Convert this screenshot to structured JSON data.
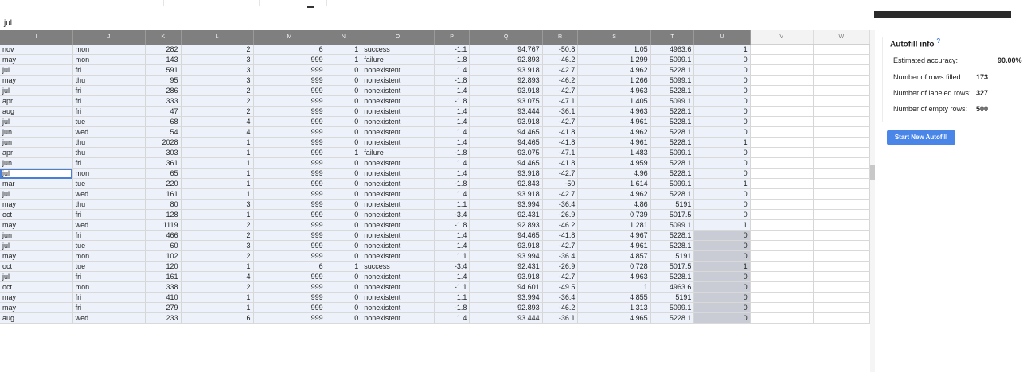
{
  "formula_bar": {
    "value": "jul"
  },
  "columns": [
    "I",
    "J",
    "K",
    "L",
    "M",
    "N",
    "O",
    "P",
    "Q",
    "R",
    "S",
    "T",
    "U",
    "V",
    "W"
  ],
  "rows": [
    [
      "nov",
      "mon",
      "282",
      "2",
      "6",
      "1",
      "success",
      "-1.1",
      "94.767",
      "-50.8",
      "1.05",
      "4963.6",
      "1"
    ],
    [
      "may",
      "mon",
      "143",
      "3",
      "999",
      "1",
      "failure",
      "-1.8",
      "92.893",
      "-46.2",
      "1.299",
      "5099.1",
      "0"
    ],
    [
      "jul",
      "fri",
      "591",
      "3",
      "999",
      "0",
      "nonexistent",
      "1.4",
      "93.918",
      "-42.7",
      "4.962",
      "5228.1",
      "0"
    ],
    [
      "may",
      "thu",
      "95",
      "3",
      "999",
      "0",
      "nonexistent",
      "-1.8",
      "92.893",
      "-46.2",
      "1.266",
      "5099.1",
      "0"
    ],
    [
      "jul",
      "fri",
      "286",
      "2",
      "999",
      "0",
      "nonexistent",
      "1.4",
      "93.918",
      "-42.7",
      "4.963",
      "5228.1",
      "0"
    ],
    [
      "apr",
      "fri",
      "333",
      "2",
      "999",
      "0",
      "nonexistent",
      "-1.8",
      "93.075",
      "-47.1",
      "1.405",
      "5099.1",
      "0"
    ],
    [
      "aug",
      "fri",
      "47",
      "2",
      "999",
      "0",
      "nonexistent",
      "1.4",
      "93.444",
      "-36.1",
      "4.963",
      "5228.1",
      "0"
    ],
    [
      "jul",
      "tue",
      "68",
      "4",
      "999",
      "0",
      "nonexistent",
      "1.4",
      "93.918",
      "-42.7",
      "4.961",
      "5228.1",
      "0"
    ],
    [
      "jun",
      "wed",
      "54",
      "4",
      "999",
      "0",
      "nonexistent",
      "1.4",
      "94.465",
      "-41.8",
      "4.962",
      "5228.1",
      "0"
    ],
    [
      "jun",
      "thu",
      "2028",
      "1",
      "999",
      "0",
      "nonexistent",
      "1.4",
      "94.465",
      "-41.8",
      "4.961",
      "5228.1",
      "1"
    ],
    [
      "apr",
      "thu",
      "303",
      "1",
      "999",
      "1",
      "failure",
      "-1.8",
      "93.075",
      "-47.1",
      "1.483",
      "5099.1",
      "0"
    ],
    [
      "jun",
      "fri",
      "361",
      "1",
      "999",
      "0",
      "nonexistent",
      "1.4",
      "94.465",
      "-41.8",
      "4.959",
      "5228.1",
      "0"
    ],
    [
      "jul",
      "mon",
      "65",
      "1",
      "999",
      "0",
      "nonexistent",
      "1.4",
      "93.918",
      "-42.7",
      "4.96",
      "5228.1",
      "0"
    ],
    [
      "mar",
      "tue",
      "220",
      "1",
      "999",
      "0",
      "nonexistent",
      "-1.8",
      "92.843",
      "-50",
      "1.614",
      "5099.1",
      "1"
    ],
    [
      "jul",
      "wed",
      "161",
      "1",
      "999",
      "0",
      "nonexistent",
      "1.4",
      "93.918",
      "-42.7",
      "4.962",
      "5228.1",
      "0"
    ],
    [
      "may",
      "thu",
      "80",
      "3",
      "999",
      "0",
      "nonexistent",
      "1.1",
      "93.994",
      "-36.4",
      "4.86",
      "5191",
      "0"
    ],
    [
      "oct",
      "fri",
      "128",
      "1",
      "999",
      "0",
      "nonexistent",
      "-3.4",
      "92.431",
      "-26.9",
      "0.739",
      "5017.5",
      "0"
    ],
    [
      "may",
      "wed",
      "1119",
      "2",
      "999",
      "0",
      "nonexistent",
      "-1.8",
      "92.893",
      "-46.2",
      "1.281",
      "5099.1",
      "1"
    ],
    [
      "jun",
      "fri",
      "466",
      "2",
      "999",
      "0",
      "nonexistent",
      "1.4",
      "94.465",
      "-41.8",
      "4.967",
      "5228.1",
      "0"
    ],
    [
      "jul",
      "tue",
      "60",
      "3",
      "999",
      "0",
      "nonexistent",
      "1.4",
      "93.918",
      "-42.7",
      "4.961",
      "5228.1",
      "0"
    ],
    [
      "may",
      "mon",
      "102",
      "2",
      "999",
      "0",
      "nonexistent",
      "1.1",
      "93.994",
      "-36.4",
      "4.857",
      "5191",
      "0"
    ],
    [
      "oct",
      "tue",
      "120",
      "1",
      "6",
      "1",
      "success",
      "-3.4",
      "92.431",
      "-26.9",
      "0.728",
      "5017.5",
      "1"
    ],
    [
      "jul",
      "fri",
      "161",
      "4",
      "999",
      "0",
      "nonexistent",
      "1.4",
      "93.918",
      "-42.7",
      "4.963",
      "5228.1",
      "0"
    ],
    [
      "oct",
      "mon",
      "338",
      "2",
      "999",
      "0",
      "nonexistent",
      "-1.1",
      "94.601",
      "-49.5",
      "1",
      "4963.6",
      "0"
    ],
    [
      "may",
      "fri",
      "410",
      "1",
      "999",
      "0",
      "nonexistent",
      "1.1",
      "93.994",
      "-36.4",
      "4.855",
      "5191",
      "0"
    ],
    [
      "may",
      "fri",
      "279",
      "1",
      "999",
      "0",
      "nonexistent",
      "-1.8",
      "92.893",
      "-46.2",
      "1.313",
      "5099.1",
      "0"
    ],
    [
      "aug",
      "wed",
      "233",
      "6",
      "999",
      "0",
      "nonexistent",
      "1.4",
      "93.444",
      "-36.1",
      "4.965",
      "5228.1",
      "0"
    ]
  ],
  "autofill_panel": {
    "title": "Autofill info",
    "help": "?",
    "estimated_accuracy_label": "Estimated accuracy:",
    "estimated_accuracy": "90.00%",
    "rows_filled_label": "Number of rows filled:",
    "rows_filled": "173",
    "labeled_rows_label": "Number of labeled rows:",
    "labeled_rows": "327",
    "empty_rows_label": "Number of empty rows:",
    "empty_rows": "500",
    "start_button": "Start New Autofill"
  }
}
